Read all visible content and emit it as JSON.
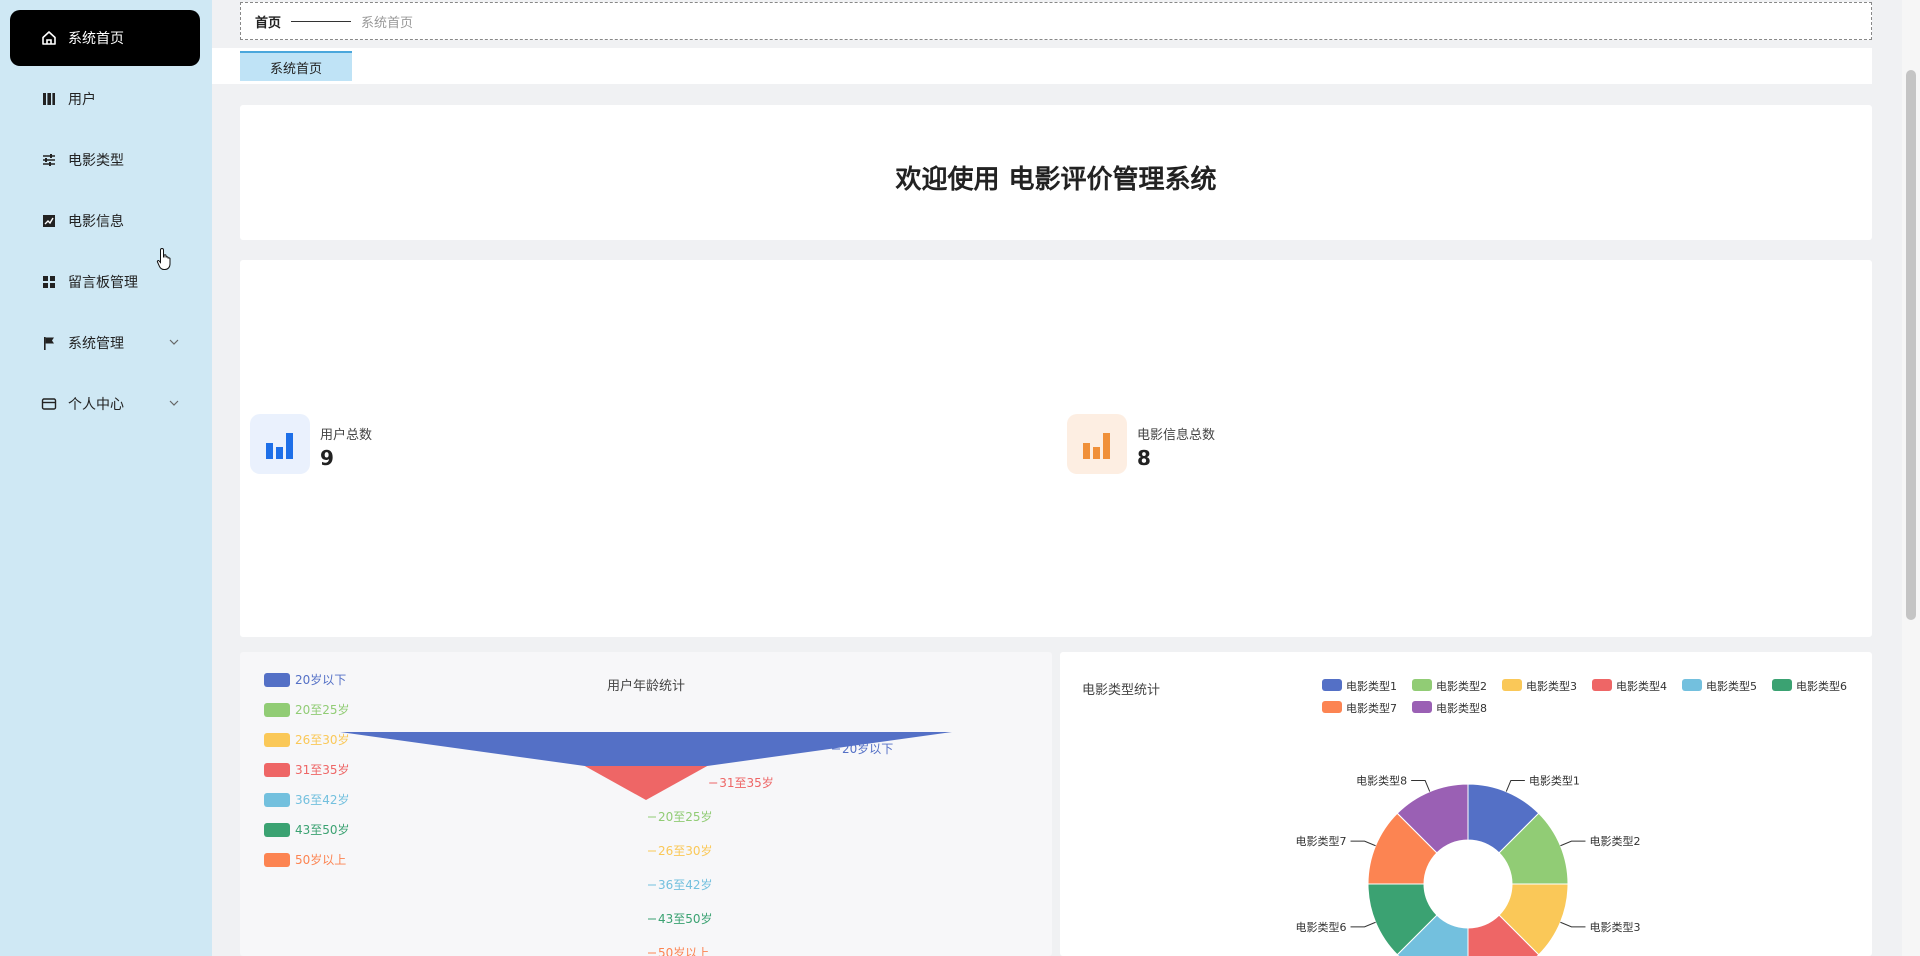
{
  "sidebar": {
    "items": [
      {
        "label": "系统首页",
        "icon": "home-icon",
        "active": true
      },
      {
        "label": "用户",
        "icon": "book-icon"
      },
      {
        "label": "电影类型",
        "icon": "sliders-icon"
      },
      {
        "label": "电影信息",
        "icon": "chart-line-icon"
      },
      {
        "label": "留言板管理",
        "icon": "grid-icon"
      },
      {
        "label": "系统管理",
        "icon": "flag-icon",
        "expandable": true
      },
      {
        "label": "个人中心",
        "icon": "card-icon",
        "expandable": true
      }
    ]
  },
  "breadcrumb": {
    "home": "首页",
    "current": "系统首页"
  },
  "tabs": [
    {
      "label": "系统首页",
      "active": true
    }
  ],
  "welcome": {
    "title": "欢迎使用 电影评价管理系统"
  },
  "stats": [
    {
      "label": "用户总数",
      "value": "9",
      "color": "#1e6fe8",
      "bg": "#eaf1fd"
    },
    {
      "label": "电影信息总数",
      "value": "8",
      "color": "#f0903a",
      "bg": "#fdeee2"
    }
  ],
  "chart_data": [
    {
      "type": "funnel",
      "title": "用户年龄统计",
      "legend_position": "left",
      "categories": [
        "20岁以下",
        "20至25岁",
        "26至30岁",
        "31至35岁",
        "36至42岁",
        "43至50岁",
        "50岁以上"
      ],
      "colors": [
        "#5470c6",
        "#91cc75",
        "#fac858",
        "#ee6666",
        "#73c0de",
        "#3ba272",
        "#fc8452"
      ],
      "values": [
        100,
        0,
        0,
        20,
        0,
        0,
        0
      ]
    },
    {
      "type": "pie",
      "title": "电影类型统计",
      "legend_position": "top-right",
      "donut": true,
      "categories": [
        "电影类型1",
        "电影类型2",
        "电影类型3",
        "电影类型4",
        "电影类型5",
        "电影类型6",
        "电影类型7",
        "电影类型8"
      ],
      "colors": [
        "#5470c6",
        "#91cc75",
        "#fac858",
        "#ee6666",
        "#73c0de",
        "#3ba272",
        "#fc8452",
        "#9a60b4"
      ],
      "values": [
        1,
        1,
        1,
        1,
        1,
        1,
        1,
        1
      ]
    }
  ]
}
